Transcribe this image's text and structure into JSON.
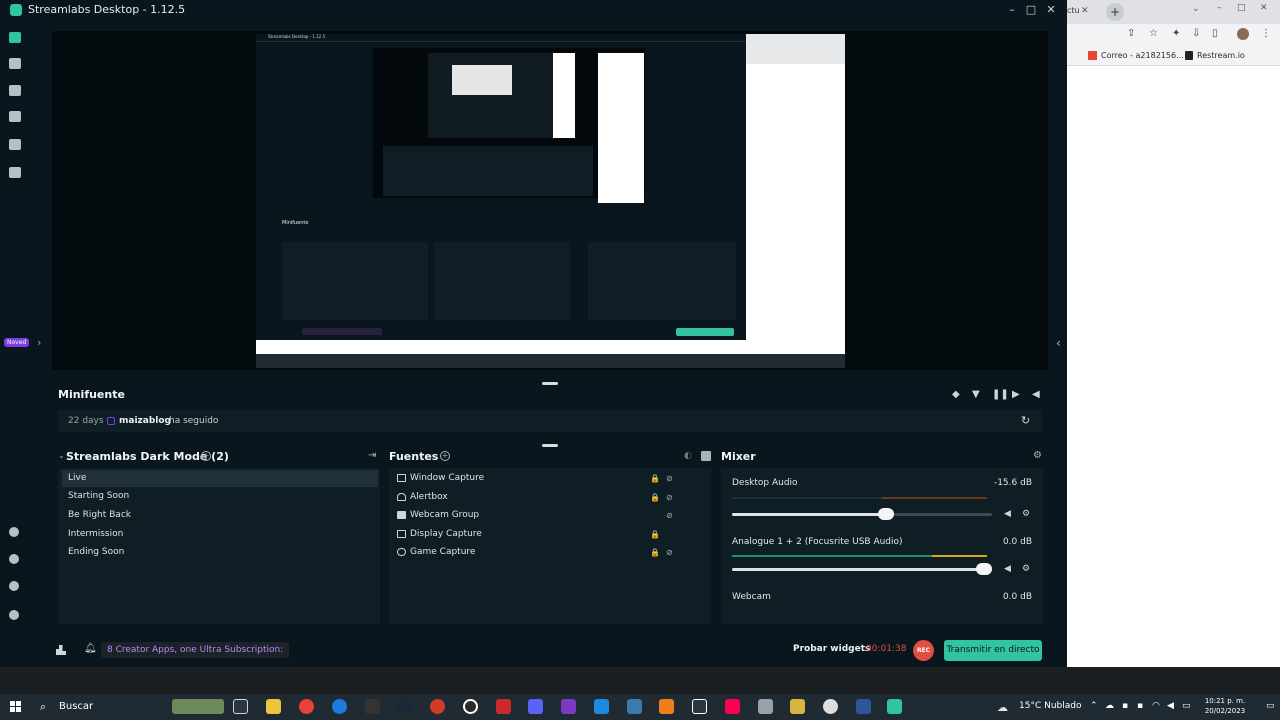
{
  "window": {
    "title": "Streamlabs Desktop - 1.12.5",
    "minimize": "–",
    "maximize": "□",
    "close": "✕"
  },
  "nav": {
    "novedades": "Noved",
    "expand": "›"
  },
  "preview": {
    "collapse": "‹",
    "inner_title": "Streamlabs Desktop - 1.12.5"
  },
  "minifuente": {
    "title": "Minifuente",
    "days": "22 days",
    "user": "maizablog",
    "action": "ha seguido",
    "refresh": "↻"
  },
  "scenes": {
    "title": "Streamlabs Dark Mode (2)",
    "items": [
      "Live",
      "Starting Soon",
      "Be Right Back",
      "Intermission",
      "Ending Soon"
    ]
  },
  "sources": {
    "title": "Fuentes",
    "items": [
      {
        "label": "Window Capture",
        "lock": "🔒",
        "eye": "⊘"
      },
      {
        "label": "Alertbox",
        "lock": "🔒",
        "eye": "⊘"
      },
      {
        "label": "Webcam Group",
        "lock": "",
        "eye": "⊘"
      },
      {
        "label": "Display Capture",
        "lock": "🔒",
        "eye": ""
      },
      {
        "label": "Game Capture",
        "lock": "🔒",
        "eye": "⊘"
      }
    ]
  },
  "mixer": {
    "title": "Mixer",
    "channels": [
      {
        "name": "Desktop Audio",
        "db": "-15.6 dB",
        "level": 0.6
      },
      {
        "name": "Analogue 1 + 2 (Focusrite USB Audio)",
        "db": "0.0 dB",
        "level": 1.0
      },
      {
        "name": "Webcam",
        "db": "0.0 dB"
      }
    ]
  },
  "footer": {
    "promo": "8 Creator Apps, one Ultra Subscription:",
    "probar": "Probar widgets",
    "timer": "00:01:38",
    "rec": "REC",
    "golive": "Transmitir en directo"
  },
  "browser": {
    "tab_fragment": "ctu",
    "bookmarks": [
      "Correo - a2182156...",
      "Restream.io"
    ]
  },
  "taskbar": {
    "search": "Buscar",
    "weather": "15°C  Nublado",
    "time": "10:21 p. m.",
    "date": "20/02/2023"
  },
  "colors": {
    "accent": "#31c3a2",
    "rec": "#e34c42",
    "promo": "#b48cf2",
    "bg": "#09161d",
    "panel": "#0f1d24"
  }
}
